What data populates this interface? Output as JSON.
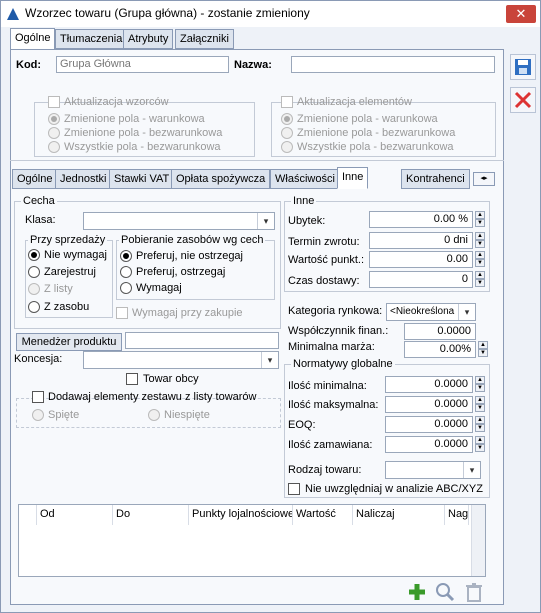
{
  "window": {
    "title": "Wzorzec towaru (Grupa główna) - zostanie zmieniony",
    "close": "✕"
  },
  "top_tabs": [
    "Ogólne",
    "Tłumaczenia",
    "Atrybuty",
    "Załączniki"
  ],
  "header": {
    "kod_label": "Kod:",
    "kod_value": "Grupa Główna",
    "nazwa_label": "Nazwa:",
    "nazwa_value": ""
  },
  "aktualizacja_wzorcow": {
    "title": "Aktualizacja wzorców",
    "options": [
      "Zmienione pola - warunkowa",
      "Zmienione pola - bezwarunkowa",
      "Wszystkie pola - bezwarunkowa"
    ]
  },
  "aktualizacja_elementow": {
    "title": "Aktualizacja elementów",
    "options": [
      "Zmienione pola - warunkowa",
      "Zmienione pola - bezwarunkowa",
      "Wszystkie pola - bezwarunkowa"
    ]
  },
  "inner_tabs": [
    "Ogólne",
    "Jednostki",
    "Stawki VAT",
    "Opłata spożywcza",
    "Właściwości",
    "Inne",
    "Kontrahenci"
  ],
  "cecha": {
    "title": "Cecha",
    "klasa_label": "Klasa:"
  },
  "przy_sprzedazy": {
    "title": "Przy sprzedaży",
    "options": [
      "Nie wymagaj",
      "Zarejestruj",
      "Z listy",
      "Z zasobu"
    ]
  },
  "pobieranie": {
    "title": "Pobieranie zasobów wg cech",
    "options": [
      "Preferuj, nie ostrzegaj",
      "Preferuj, ostrzegaj",
      "Wymagaj"
    ],
    "wymagaj_przy_zakupie": "Wymagaj przy zakupie"
  },
  "menedzer": "Menedżer produktu",
  "koncesja": "Koncesja:",
  "towar_obcy": "Towar obcy",
  "zestaw": {
    "label": "Dodawaj elementy zestawu z listy towarów",
    "options": [
      "Spięte",
      "Niespięte"
    ]
  },
  "inne": {
    "title": "Inne",
    "fields": [
      {
        "label": "Ubytek:",
        "value": "0.00 %"
      },
      {
        "label": "Termin zwrotu:",
        "value": "0 dni"
      },
      {
        "label": "Wartość punkt.:",
        "value": "0.00"
      },
      {
        "label": "Czas dostawy:",
        "value": "0"
      }
    ]
  },
  "kategoria": {
    "label": "Kategoria rynkowa:",
    "value": "<Nieokreślona"
  },
  "wspolczynnik": {
    "label": "Współczynnik finan.:",
    "value": "0.0000"
  },
  "marza": {
    "label": "Minimalna marża:",
    "value": "0.00%"
  },
  "normatywy": {
    "title": "Normatywy globalne",
    "fields": [
      {
        "label": "Ilość minimalna:",
        "value": "0.0000"
      },
      {
        "label": "Ilość maksymalna:",
        "value": "0.0000"
      },
      {
        "label": "EOQ:",
        "value": "0.0000"
      },
      {
        "label": "Ilość zamawiana:",
        "value": "0.0000"
      }
    ],
    "rodzaj": "Rodzaj towaru:",
    "abc": "Nie uwzględniaj w analizie ABC/XYZ"
  },
  "grid": {
    "columns": [
      "Od",
      "Do",
      "Punkty lojalnościowe",
      "Wartość",
      "Naliczaj",
      "Nag"
    ]
  },
  "colors": {
    "accent": "#1e5aa8",
    "frame": "#8a9ab5"
  }
}
